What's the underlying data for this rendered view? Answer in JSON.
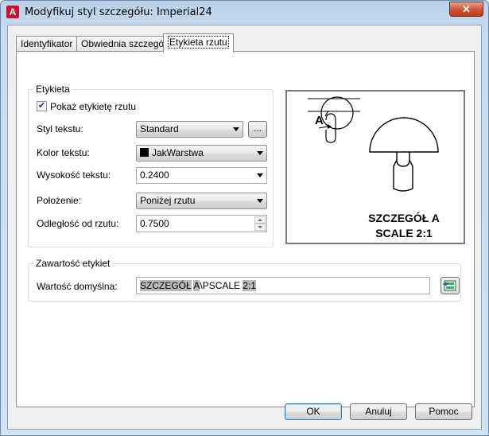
{
  "window": {
    "title": "Modyfikuj styl szczegółu: Imperial24",
    "close_glyph": "✕"
  },
  "tabs": [
    {
      "label": "Identyfikator",
      "active": false
    },
    {
      "label": "Obwiednia szczegółu",
      "active": false
    },
    {
      "label": "Etykieta rzutu",
      "active": true
    }
  ],
  "etykieta": {
    "group_label": "Etykieta",
    "show_label": {
      "label": "Pokaż etykietę rzutu",
      "checked": true
    },
    "text_style": {
      "label": "Styl tekstu:",
      "value": "Standard",
      "browse_label": "..."
    },
    "text_color": {
      "label": "Kolor tekstu:",
      "value": "JakWarstwa",
      "swatch_color": "#000000"
    },
    "text_height": {
      "label": "Wysokość tekstu:",
      "value": "0.2400"
    },
    "position": {
      "label": "Położenie:",
      "value": "Poniżej rzutu"
    },
    "offset": {
      "label": "Odległość od rzutu:",
      "value": "0.7500"
    }
  },
  "preview": {
    "label_line1": "SZCZEGÓŁ A",
    "label_line2": "SCALE 2:1",
    "bubble_letter": "A"
  },
  "zawartosc": {
    "group_label": "Zawartość etykiet",
    "default_value": {
      "label": "Wartość domyślna:",
      "value_parts": [
        "SZCZEGÓŁ",
        " ",
        "A",
        "\\PSCALE ",
        "2:1"
      ]
    }
  },
  "buttons": {
    "ok": "OK",
    "cancel": "Anuluj",
    "help": "Pomoc"
  },
  "colors": {
    "accent": "#3c7fb1",
    "titlebar": "#b9d1ea",
    "close": "#c2391a"
  }
}
